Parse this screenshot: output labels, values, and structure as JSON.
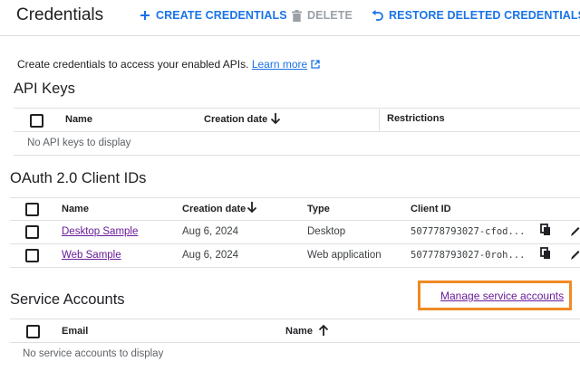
{
  "header": {
    "title": "Credentials",
    "create_label": "CREATE CREDENTIALS",
    "delete_label": "DELETE",
    "restore_label": "RESTORE DELETED CREDENTIALS"
  },
  "intro": {
    "text": "Create credentials to access your enabled APIs.",
    "link": "Learn more"
  },
  "api_keys": {
    "title": "API Keys",
    "columns": [
      "Name",
      "Creation date",
      "Restrictions"
    ],
    "empty": "No API keys to display"
  },
  "oauth": {
    "title": "OAuth 2.0 Client IDs",
    "columns": [
      "Name",
      "Creation date",
      "Type",
      "Client ID"
    ],
    "rows": [
      {
        "name": "Desktop Sample",
        "date": "Aug 6, 2024",
        "type": "Desktop",
        "client_id": "507778793027-cfod..."
      },
      {
        "name": "Web Sample",
        "date": "Aug 6, 2024",
        "type": "Web application",
        "client_id": "507778793027-0roh..."
      }
    ]
  },
  "service_accounts": {
    "title": "Service Accounts",
    "manage_link": "Manage service accounts",
    "columns": [
      "Email",
      "Name"
    ],
    "empty": "No service accounts to display"
  },
  "colors": {
    "accent": "#1a73e8",
    "visited_link": "#6a1b9a",
    "highlight": "#f08a24"
  }
}
